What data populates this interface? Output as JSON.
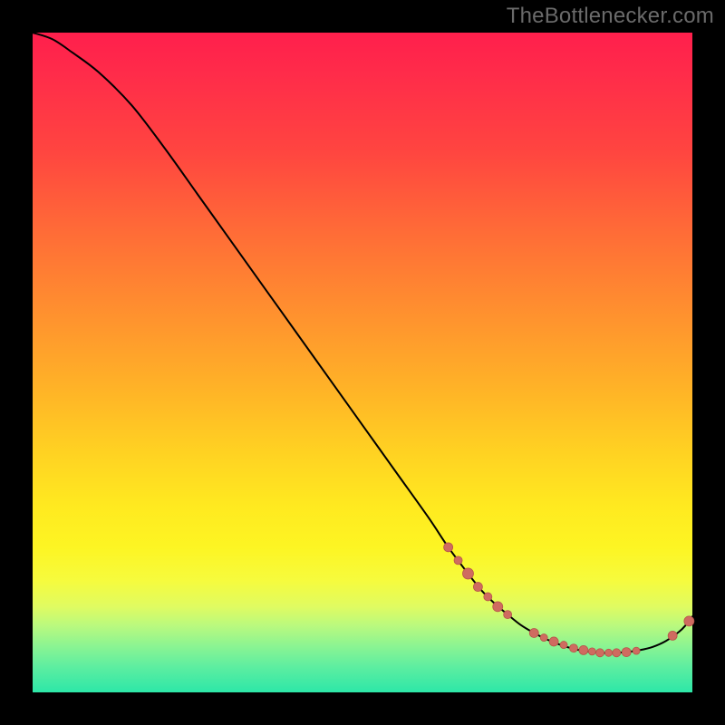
{
  "watermark": "TheBottlenecker.com",
  "colors": {
    "curve": "#000000",
    "marker_fill": "#cf6b60",
    "marker_stroke": "#b75549"
  },
  "chart_data": {
    "type": "line",
    "title": "",
    "xlabel": "",
    "ylabel": "",
    "xlim": [
      0,
      100
    ],
    "ylim": [
      0,
      100
    ],
    "series": [
      {
        "name": "curve",
        "x": [
          0,
          3,
          6,
          10,
          15,
          20,
          25,
          30,
          35,
          40,
          45,
          50,
          55,
          60,
          63,
          66,
          68,
          70,
          72,
          74,
          76,
          78,
          80,
          82,
          84,
          86,
          88,
          90,
          92,
          94,
          96,
          98,
          99,
          100
        ],
        "y": [
          100,
          99,
          97,
          94,
          89,
          82.5,
          75.5,
          68.5,
          61.5,
          54.5,
          47.5,
          40.5,
          33.5,
          26.5,
          22,
          18,
          15.5,
          13.5,
          11.8,
          10.2,
          9,
          8,
          7.2,
          6.6,
          6.2,
          6,
          6,
          6.1,
          6.4,
          6.9,
          7.8,
          9.2,
          10.2,
          11.5
        ]
      }
    ],
    "markers": [
      {
        "x": 63.0,
        "y": 22.0,
        "r": 5.0
      },
      {
        "x": 64.5,
        "y": 20.0,
        "r": 4.5
      },
      {
        "x": 66.0,
        "y": 18.0,
        "r": 6.0
      },
      {
        "x": 67.5,
        "y": 16.0,
        "r": 5.0
      },
      {
        "x": 69.0,
        "y": 14.5,
        "r": 4.5
      },
      {
        "x": 70.5,
        "y": 13.0,
        "r": 5.5
      },
      {
        "x": 72.0,
        "y": 11.8,
        "r": 4.5
      },
      {
        "x": 76.0,
        "y": 9.0,
        "r": 5.0
      },
      {
        "x": 77.5,
        "y": 8.3,
        "r": 4.0
      },
      {
        "x": 79.0,
        "y": 7.7,
        "r": 5.0
      },
      {
        "x": 80.5,
        "y": 7.2,
        "r": 4.0
      },
      {
        "x": 82.0,
        "y": 6.7,
        "r": 4.5
      },
      {
        "x": 83.5,
        "y": 6.4,
        "r": 5.0
      },
      {
        "x": 84.8,
        "y": 6.2,
        "r": 4.0
      },
      {
        "x": 86.0,
        "y": 6.0,
        "r": 4.5
      },
      {
        "x": 87.3,
        "y": 6.0,
        "r": 4.0
      },
      {
        "x": 88.5,
        "y": 6.0,
        "r": 4.5
      },
      {
        "x": 90.0,
        "y": 6.1,
        "r": 5.0
      },
      {
        "x": 91.5,
        "y": 6.3,
        "r": 4.0
      },
      {
        "x": 97.0,
        "y": 8.6,
        "r": 5.0
      },
      {
        "x": 99.5,
        "y": 10.8,
        "r": 5.5
      }
    ]
  }
}
